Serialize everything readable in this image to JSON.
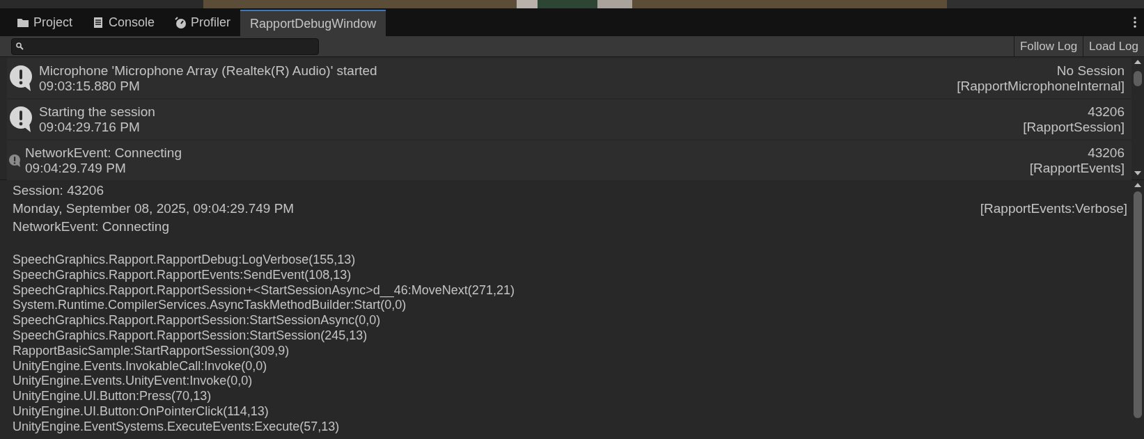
{
  "tabs": [
    {
      "label": "Project",
      "kind": "folder",
      "selected": false
    },
    {
      "label": "Console",
      "kind": "console",
      "selected": false
    },
    {
      "label": "Profiler",
      "kind": "profiler",
      "selected": false
    },
    {
      "label": "RapportDebugWindow",
      "selected": true
    }
  ],
  "toolbar": {
    "buttons": [
      "Follow Log",
      "Load Log"
    ]
  },
  "log_entries": [
    {
      "kind": "large",
      "message": "Microphone 'Microphone Array (Realtek(R) Audio)' started",
      "time": "09:03:15.880 PM",
      "session": "No Session",
      "source": "[RapportMicrophoneInternal]"
    },
    {
      "kind": "large",
      "message": "Starting the session",
      "time": "09:04:29.716 PM",
      "session": "43206",
      "source": "[RapportSession]"
    },
    {
      "kind": "small",
      "message": "NetworkEvent: Connecting",
      "time": "09:04:29.749 PM",
      "session": "43206",
      "source": "[RapportEvents]"
    }
  ],
  "detail": {
    "session": "Session: 43206",
    "date": "Monday, September 08, 2025, 09:04:29.749 PM",
    "source": "[RapportEvents:Verbose]",
    "message": "NetworkEvent: Connecting",
    "stack_trace": [
      "SpeechGraphics.Rapport.RapportDebug:LogVerbose(155,13)",
      "SpeechGraphics.Rapport.RapportEvents:SendEvent(108,13)",
      "SpeechGraphics.Rapport.RapportSession+<StartSessionAsync>d__46:MoveNext(271,21)",
      "System.Runtime.CompilerServices.AsyncTaskMethodBuilder:Start(0,0)",
      "SpeechGraphics.Rapport.RapportSession:StartSessionAsync(0,0)",
      "SpeechGraphics.Rapport.RapportSession:StartSession(245,13)",
      "RapportBasicSample:StartRapportSession(309,9)",
      "UnityEngine.Events.InvokableCall:Invoke(0,0)",
      "UnityEngine.Events.UnityEvent:Invoke(0,0)",
      "UnityEngine.UI.Button:Press(70,13)",
      "UnityEngine.UI.Button:OnPointerClick(114,13)",
      "UnityEngine.EventSystems.ExecuteEvents:Execute(57,13)"
    ]
  }
}
